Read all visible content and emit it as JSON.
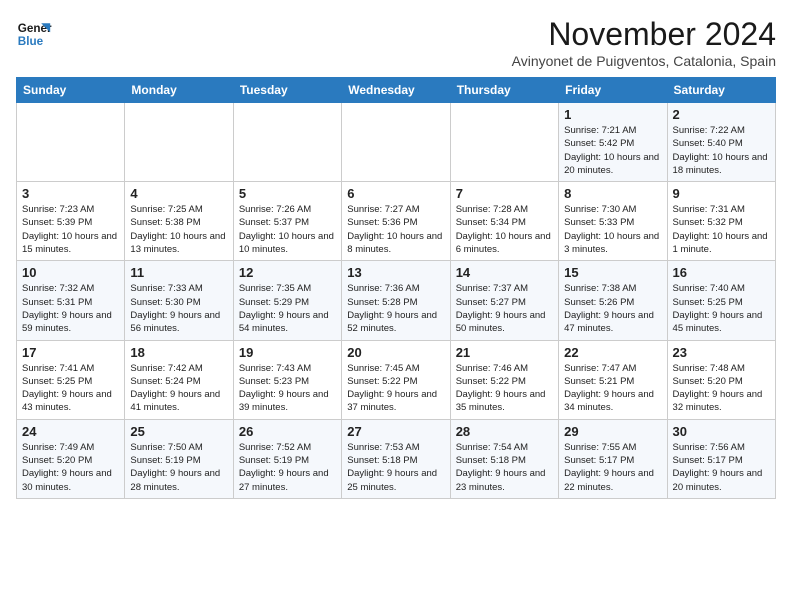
{
  "header": {
    "logo_line1": "General",
    "logo_line2": "Blue",
    "month": "November 2024",
    "location": "Avinyonet de Puigventos, Catalonia, Spain"
  },
  "days_of_week": [
    "Sunday",
    "Monday",
    "Tuesday",
    "Wednesday",
    "Thursday",
    "Friday",
    "Saturday"
  ],
  "weeks": [
    [
      {
        "day": "",
        "info": ""
      },
      {
        "day": "",
        "info": ""
      },
      {
        "day": "",
        "info": ""
      },
      {
        "day": "",
        "info": ""
      },
      {
        "day": "",
        "info": ""
      },
      {
        "day": "1",
        "info": "Sunrise: 7:21 AM\nSunset: 5:42 PM\nDaylight: 10 hours and 20 minutes."
      },
      {
        "day": "2",
        "info": "Sunrise: 7:22 AM\nSunset: 5:40 PM\nDaylight: 10 hours and 18 minutes."
      }
    ],
    [
      {
        "day": "3",
        "info": "Sunrise: 7:23 AM\nSunset: 5:39 PM\nDaylight: 10 hours and 15 minutes."
      },
      {
        "day": "4",
        "info": "Sunrise: 7:25 AM\nSunset: 5:38 PM\nDaylight: 10 hours and 13 minutes."
      },
      {
        "day": "5",
        "info": "Sunrise: 7:26 AM\nSunset: 5:37 PM\nDaylight: 10 hours and 10 minutes."
      },
      {
        "day": "6",
        "info": "Sunrise: 7:27 AM\nSunset: 5:36 PM\nDaylight: 10 hours and 8 minutes."
      },
      {
        "day": "7",
        "info": "Sunrise: 7:28 AM\nSunset: 5:34 PM\nDaylight: 10 hours and 6 minutes."
      },
      {
        "day": "8",
        "info": "Sunrise: 7:30 AM\nSunset: 5:33 PM\nDaylight: 10 hours and 3 minutes."
      },
      {
        "day": "9",
        "info": "Sunrise: 7:31 AM\nSunset: 5:32 PM\nDaylight: 10 hours and 1 minute."
      }
    ],
    [
      {
        "day": "10",
        "info": "Sunrise: 7:32 AM\nSunset: 5:31 PM\nDaylight: 9 hours and 59 minutes."
      },
      {
        "day": "11",
        "info": "Sunrise: 7:33 AM\nSunset: 5:30 PM\nDaylight: 9 hours and 56 minutes."
      },
      {
        "day": "12",
        "info": "Sunrise: 7:35 AM\nSunset: 5:29 PM\nDaylight: 9 hours and 54 minutes."
      },
      {
        "day": "13",
        "info": "Sunrise: 7:36 AM\nSunset: 5:28 PM\nDaylight: 9 hours and 52 minutes."
      },
      {
        "day": "14",
        "info": "Sunrise: 7:37 AM\nSunset: 5:27 PM\nDaylight: 9 hours and 50 minutes."
      },
      {
        "day": "15",
        "info": "Sunrise: 7:38 AM\nSunset: 5:26 PM\nDaylight: 9 hours and 47 minutes."
      },
      {
        "day": "16",
        "info": "Sunrise: 7:40 AM\nSunset: 5:25 PM\nDaylight: 9 hours and 45 minutes."
      }
    ],
    [
      {
        "day": "17",
        "info": "Sunrise: 7:41 AM\nSunset: 5:25 PM\nDaylight: 9 hours and 43 minutes."
      },
      {
        "day": "18",
        "info": "Sunrise: 7:42 AM\nSunset: 5:24 PM\nDaylight: 9 hours and 41 minutes."
      },
      {
        "day": "19",
        "info": "Sunrise: 7:43 AM\nSunset: 5:23 PM\nDaylight: 9 hours and 39 minutes."
      },
      {
        "day": "20",
        "info": "Sunrise: 7:45 AM\nSunset: 5:22 PM\nDaylight: 9 hours and 37 minutes."
      },
      {
        "day": "21",
        "info": "Sunrise: 7:46 AM\nSunset: 5:22 PM\nDaylight: 9 hours and 35 minutes."
      },
      {
        "day": "22",
        "info": "Sunrise: 7:47 AM\nSunset: 5:21 PM\nDaylight: 9 hours and 34 minutes."
      },
      {
        "day": "23",
        "info": "Sunrise: 7:48 AM\nSunset: 5:20 PM\nDaylight: 9 hours and 32 minutes."
      }
    ],
    [
      {
        "day": "24",
        "info": "Sunrise: 7:49 AM\nSunset: 5:20 PM\nDaylight: 9 hours and 30 minutes."
      },
      {
        "day": "25",
        "info": "Sunrise: 7:50 AM\nSunset: 5:19 PM\nDaylight: 9 hours and 28 minutes."
      },
      {
        "day": "26",
        "info": "Sunrise: 7:52 AM\nSunset: 5:19 PM\nDaylight: 9 hours and 27 minutes."
      },
      {
        "day": "27",
        "info": "Sunrise: 7:53 AM\nSunset: 5:18 PM\nDaylight: 9 hours and 25 minutes."
      },
      {
        "day": "28",
        "info": "Sunrise: 7:54 AM\nSunset: 5:18 PM\nDaylight: 9 hours and 23 minutes."
      },
      {
        "day": "29",
        "info": "Sunrise: 7:55 AM\nSunset: 5:17 PM\nDaylight: 9 hours and 22 minutes."
      },
      {
        "day": "30",
        "info": "Sunrise: 7:56 AM\nSunset: 5:17 PM\nDaylight: 9 hours and 20 minutes."
      }
    ]
  ]
}
